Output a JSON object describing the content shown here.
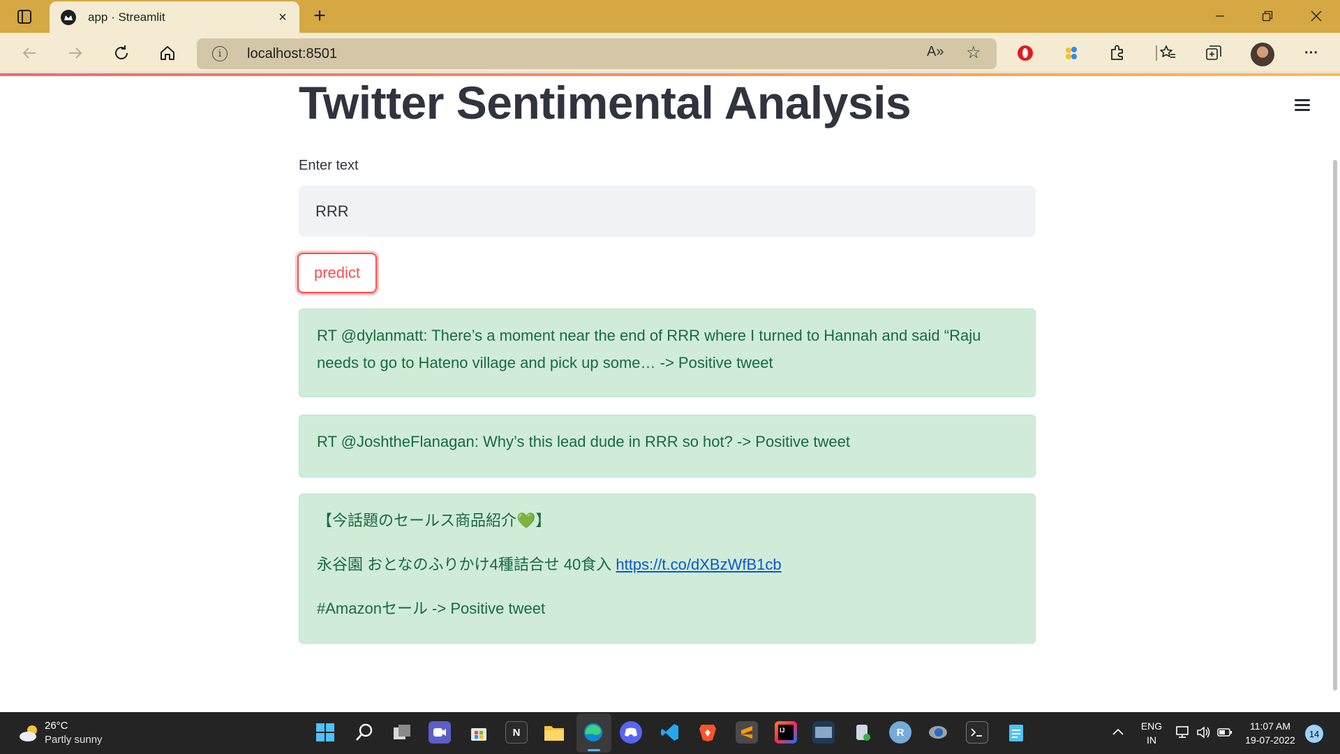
{
  "browser": {
    "tab_title": "app · Streamlit",
    "tab_close": "×",
    "new_tab": "+",
    "url": "localhost:8501",
    "info_glyph": "i",
    "read_aloud_glyph": "A»",
    "favorite_glyph": "☆",
    "more_glyph": "···"
  },
  "app": {
    "title": "Twitter Sentimental Analysis",
    "input_label": "Enter text",
    "input_value": "RRR",
    "predict_label": "predict",
    "results": [
      {
        "lines": [
          "RT @dylanmatt: There’s a moment near the end of RRR where I turned to Hannah and said “Raju needs to go to Hateno village and pick up some… -> Positive tweet"
        ]
      },
      {
        "lines": [
          "RT @JoshtheFlanagan: Why’s this lead dude in RRR so hot? -> Positive tweet"
        ]
      },
      {
        "lines": [
          "【今話題のセールス商品紹介💚】"
        ],
        "line2_text": "永谷園 おとなのふりかけ4種詰合せ 40食入 ",
        "line2_link": "https://t.co/dXBzWfB1cb",
        "line3": "#Amazonセール -> Positive tweet"
      }
    ]
  },
  "taskbar": {
    "temperature": "26°C",
    "weather": "Partly sunny",
    "lang_top": "ENG",
    "lang_bottom": "IN",
    "time": "11:07 AM",
    "date": "19-07-2022",
    "notifications": "14"
  },
  "colors": {
    "tab_strip": "#d5a843",
    "toolbar": "#f4ebd2",
    "streamlit_red": "#ff4b4b",
    "success_bg": "#d0ecd9",
    "success_text": "#176b3c"
  }
}
